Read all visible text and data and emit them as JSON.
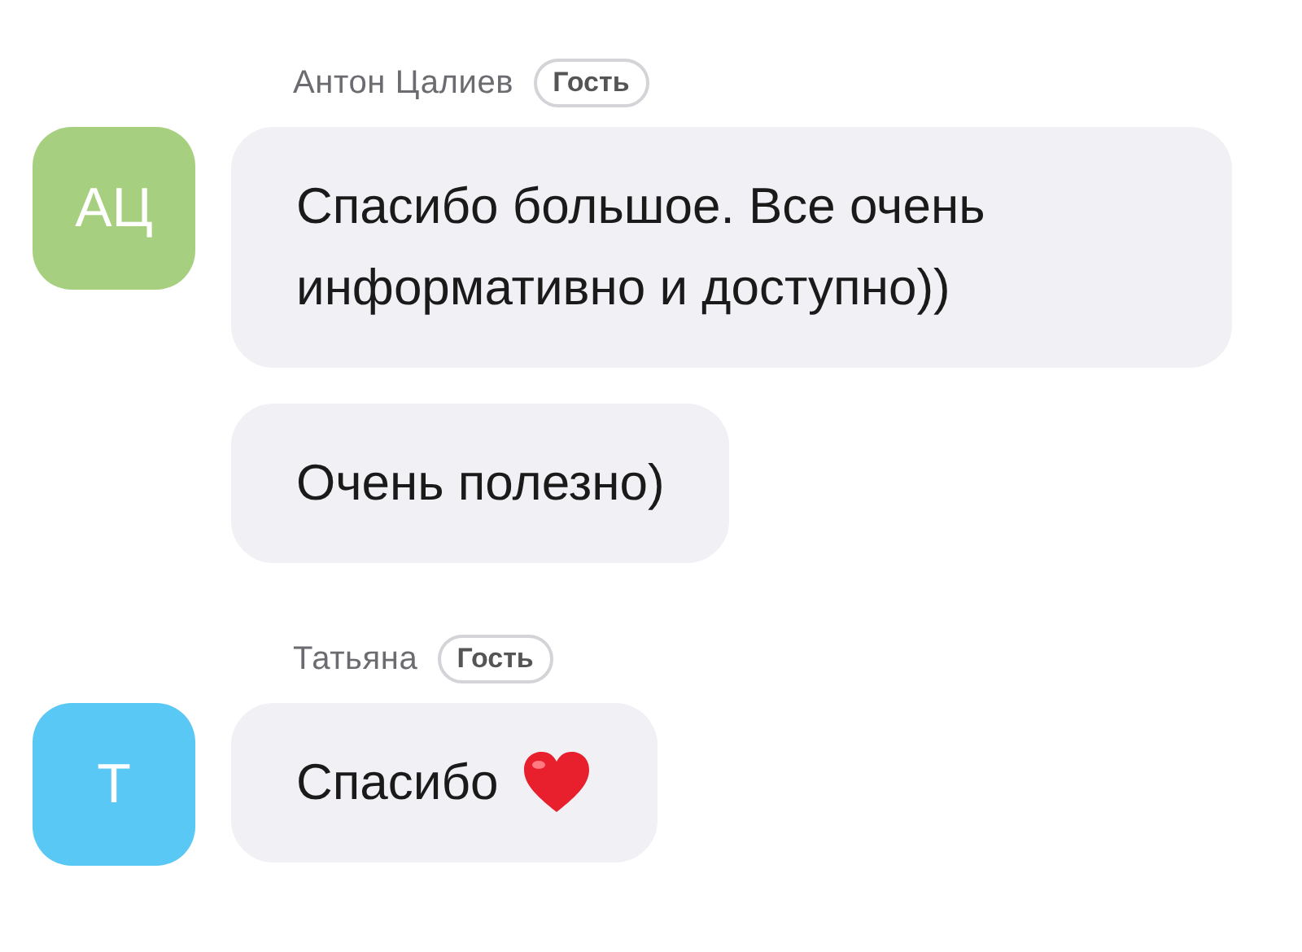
{
  "chat": [
    {
      "author": "Антон Цалиев",
      "badge": "Гость",
      "initials": "АЦ",
      "color": "#a6d07f",
      "messages": [
        {
          "text": "Спасибо большое. Все очень информативно и доступно))",
          "heart": false
        },
        {
          "text": "Очень полезно)",
          "heart": false
        }
      ]
    },
    {
      "author": "Татьяна",
      "badge": "Гость",
      "initials": "Т",
      "color": "#5ac8f5",
      "messages": [
        {
          "text": "Спасибо",
          "heart": true
        }
      ]
    }
  ]
}
